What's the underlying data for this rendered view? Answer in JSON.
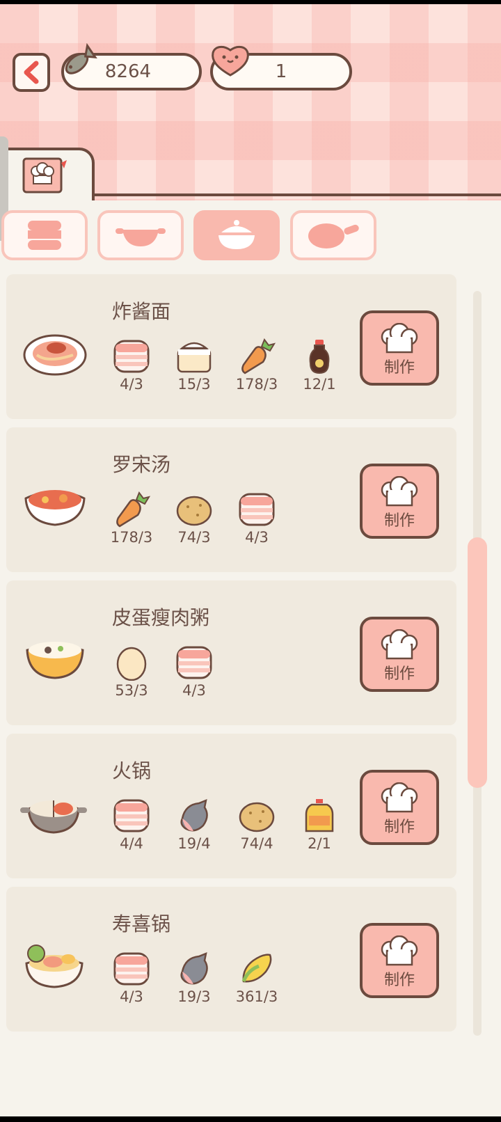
{
  "header": {
    "fish_currency": "8264",
    "heart_count": "1"
  },
  "make_label": "制作",
  "recipes": [
    {
      "name": "炸酱面",
      "ingredients": [
        {
          "icon": "meat-icon",
          "count": "4/3"
        },
        {
          "icon": "flour-icon",
          "count": "15/3"
        },
        {
          "icon": "carrot-icon",
          "count": "178/3"
        },
        {
          "icon": "soy-sauce-icon",
          "count": "12/1"
        }
      ]
    },
    {
      "name": "罗宋汤",
      "ingredients": [
        {
          "icon": "carrot-icon",
          "count": "178/3"
        },
        {
          "icon": "potato-icon",
          "count": "74/3"
        },
        {
          "icon": "meat-icon",
          "count": "4/3"
        }
      ]
    },
    {
      "name": "皮蛋瘦肉粥",
      "ingredients": [
        {
          "icon": "egg-icon",
          "count": "53/3"
        },
        {
          "icon": "meat-icon",
          "count": "4/3"
        }
      ]
    },
    {
      "name": "火锅",
      "ingredients": [
        {
          "icon": "meat-icon",
          "count": "4/4"
        },
        {
          "icon": "fish-icon",
          "count": "19/4"
        },
        {
          "icon": "potato-icon",
          "count": "74/4"
        },
        {
          "icon": "oil-icon",
          "count": "2/1"
        }
      ]
    },
    {
      "name": "寿喜锅",
      "ingredients": [
        {
          "icon": "meat-icon",
          "count": "4/3"
        },
        {
          "icon": "fish-icon",
          "count": "19/3"
        },
        {
          "icon": "corn-icon",
          "count": "361/3"
        }
      ]
    }
  ],
  "colors": {
    "accent": "#f9b9ae",
    "outline": "#6b4a3e",
    "card": "#f0eadf"
  }
}
